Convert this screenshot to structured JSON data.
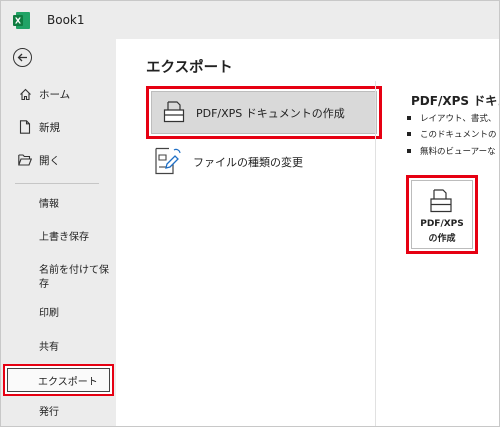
{
  "window": {
    "title": "Book1",
    "app_icon": "excel-icon"
  },
  "sidebar": {
    "back_icon": "back-arrow-icon",
    "items": [
      {
        "label": "ホーム",
        "icon": "home-icon"
      },
      {
        "label": "新規",
        "icon": "new-file-icon"
      },
      {
        "label": "開く",
        "icon": "folder-open-icon"
      }
    ],
    "sub_items": [
      {
        "label": "情報"
      },
      {
        "label": "上書き保存"
      },
      {
        "label": "名前を付けて保存"
      },
      {
        "label": "印刷"
      },
      {
        "label": "共有"
      },
      {
        "label": "エクスポート",
        "selected": true
      },
      {
        "label": "発行"
      }
    ]
  },
  "main": {
    "title": "エクスポート",
    "options": [
      {
        "label": "PDF/XPS ドキュメントの作成",
        "icon": "printer-icon",
        "selected": true
      },
      {
        "label": "ファイルの種類の変更",
        "icon": "change-file-type-icon"
      }
    ]
  },
  "detail": {
    "title": "PDF/XPS ドキュ",
    "bullets": [
      "レイアウト、書式、",
      "このドキュメントの",
      "無料のビューアーな"
    ],
    "create_button": {
      "line1": "PDF/XPS",
      "line2": "の作成",
      "icon": "document-icon"
    }
  },
  "colors": {
    "highlight_border": "#e60012",
    "excel_green": "#107c41",
    "sidebar_bg": "#ececec"
  }
}
